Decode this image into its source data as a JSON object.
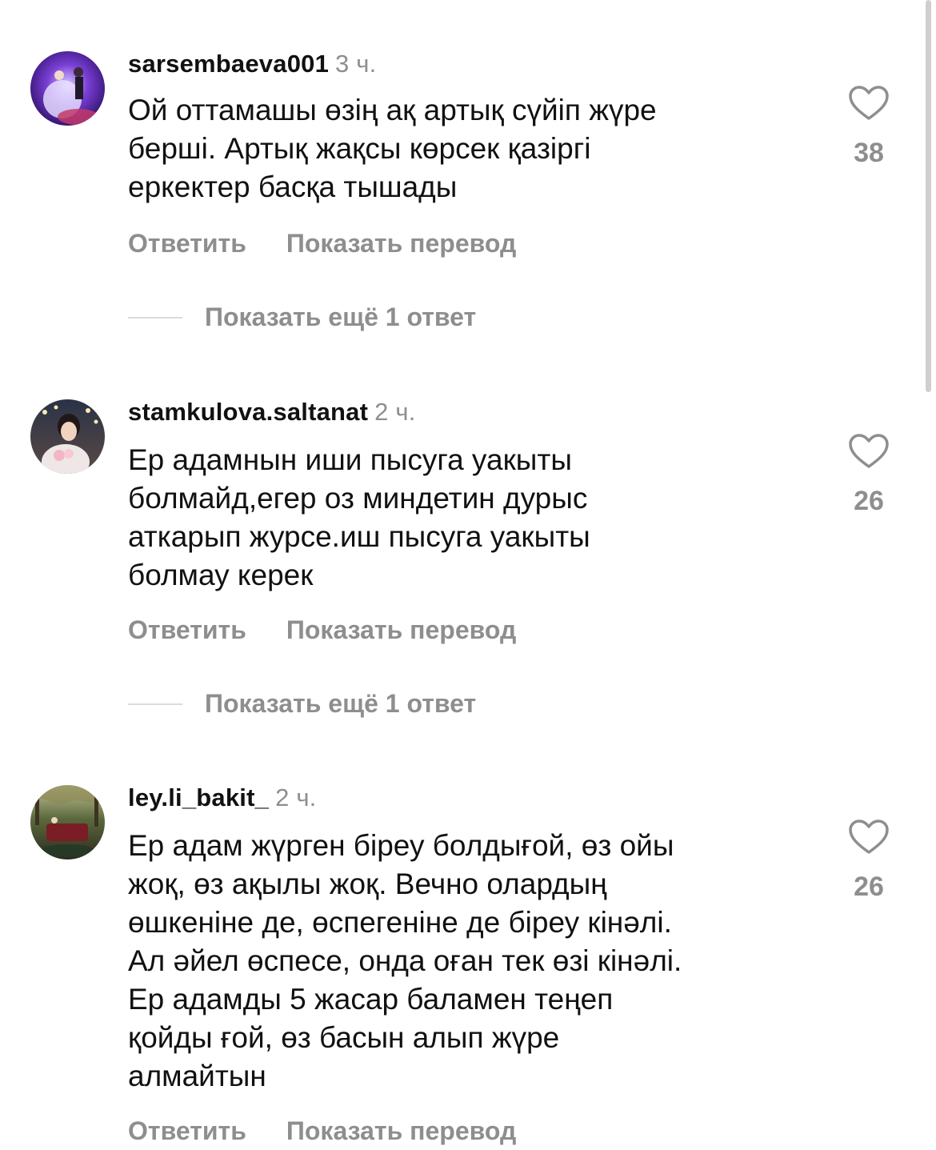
{
  "comments": [
    {
      "username": "sarsembaeva001",
      "time": "3 ч.",
      "lines": [
        "Ой оттамашы өзің ақ артық сүйіп жүре",
        "берші. Артық жақсы көрсек қазіргі",
        "еркектер басқа тышады"
      ],
      "likes": "38",
      "reply_label": "Ответить",
      "translate_label": "Показать перевод",
      "more_replies": "Показать ещё 1 ответ"
    },
    {
      "username": "stamkulova.saltanat",
      "time": "2 ч.",
      "lines": [
        "Ер адамнын иши пысуга уакыты",
        "болмайд,егер оз миндетин дурыс",
        "аткарып журсе.иш пысуга уакыты",
        "болмау керек"
      ],
      "likes": "26",
      "reply_label": "Ответить",
      "translate_label": "Показать перевод",
      "more_replies": "Показать ещё 1 ответ"
    },
    {
      "username": "ley.li_bakit_",
      "time": "2 ч.",
      "lines": [
        "Ер адам жүрген біреу болдығой, өз ойы",
        "жоқ, өз ақылы жоқ. Вечно олардың",
        "өшкеніне де, өспегеніне де біреу кінәлі.",
        "Ал әйел өспесе, онда оған тек өзі кінәлі.",
        "Ер адамды 5 жасар баламен теңеп",
        "қойды ғой, өз басын алып жүре",
        "алмайтын"
      ],
      "likes": "26",
      "reply_label": "Ответить",
      "translate_label": "Показать перевод"
    }
  ],
  "icons": {
    "like": "heart-outline-icon"
  },
  "colors": {
    "text": "#111111",
    "secondary": "#8e8e8e",
    "divider": "#dbdbdb"
  }
}
